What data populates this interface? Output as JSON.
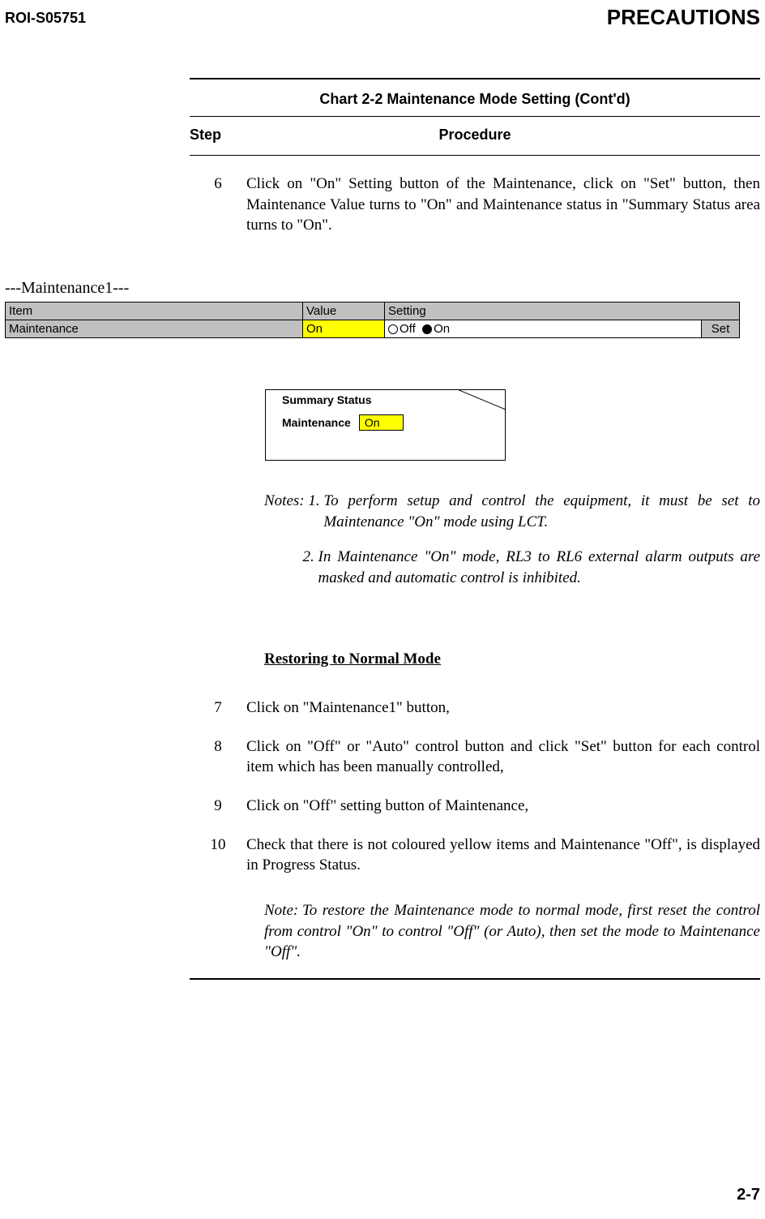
{
  "header": {
    "doc_id": "ROI-S05751",
    "section": "PRECAUTIONS"
  },
  "chart": {
    "title": "Chart 2-2  Maintenance Mode Setting (Cont'd)",
    "step_label": "Step",
    "procedure_label": "Procedure"
  },
  "step6": {
    "num": "6",
    "text": "Click on \"On\" Setting button of the Maintenance, click on \"Set\" button, then Maintenance Value turns to \"On\" and Maintenance status in \"Summary Status area turns to \"On\"."
  },
  "maintenance_section": {
    "label": "---Maintenance1---",
    "table": {
      "headers": {
        "item": "Item",
        "value": "Value",
        "setting": "Setting"
      },
      "row": {
        "item": "Maintenance",
        "value": "On",
        "off": "Off",
        "on": "On",
        "set": "Set"
      }
    }
  },
  "summary": {
    "title": "Summary Status",
    "maintenance_label": "Maintenance",
    "maintenance_value": "On"
  },
  "notes": {
    "prefix": "Notes: ",
    "n1_num": "1. ",
    "n1": "To perform setup and control the equipment, it must be set to Maintenance \"On\" mode using LCT.",
    "n2_num": "2. ",
    "n2": "In Maintenance \"On\" mode, RL3 to RL6 external alarm outputs are masked and automatic control is inhibited."
  },
  "restoring": "Restoring to Normal Mode",
  "steps_lower": [
    {
      "num": "7",
      "text": "Click on \"Maintenance1\" button,"
    },
    {
      "num": "8",
      "text": "Click on \"Off\" or \"Auto\" control button and click \"Set\" button for each control item which has been manually controlled,"
    },
    {
      "num": "9",
      "text": "Click on \"Off\" setting button of Maintenance,"
    },
    {
      "num": "10",
      "text": "Check that there is not coloured yellow items and Maintenance \"Off\", is displayed in Progress Status."
    }
  ],
  "final_note": {
    "prefix": "Note: ",
    "text": "To restore the Maintenance mode to normal mode, first reset the control from control \"On\" to control \"Off\" (or Auto), then set the mode to Maintenance \"Off\"."
  },
  "page_number": "2-7"
}
